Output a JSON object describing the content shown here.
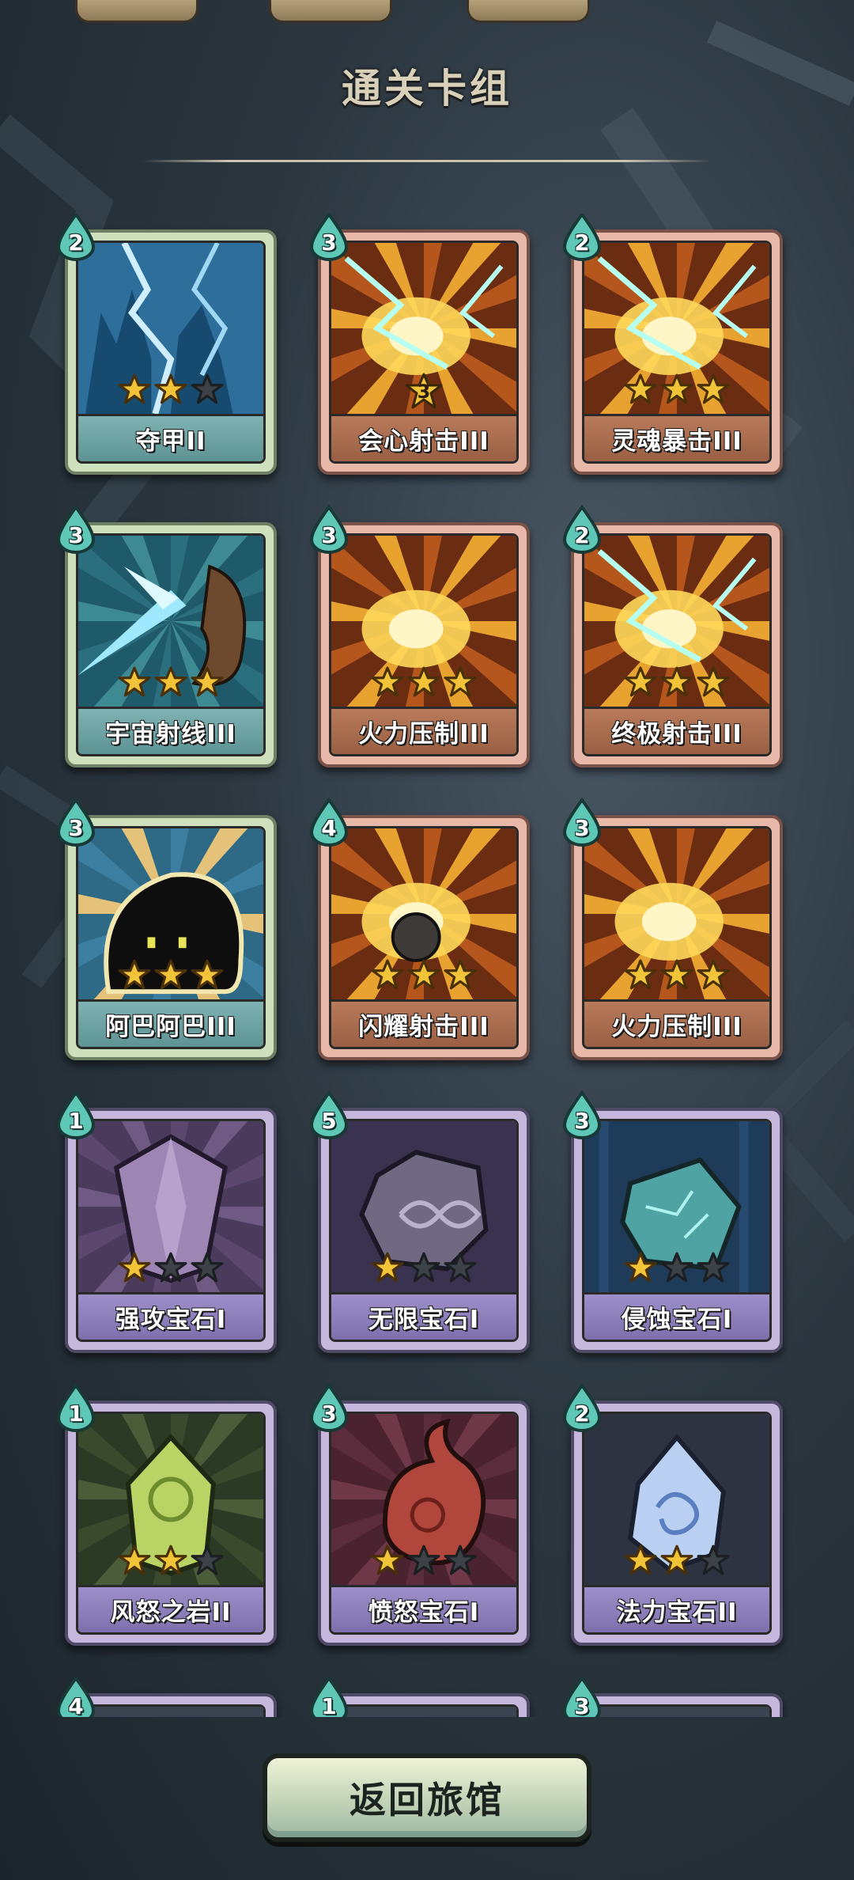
{
  "screen": {
    "title": "通关卡组"
  },
  "cards": [
    {
      "name": "夺甲II",
      "cost": "2",
      "stars": 2,
      "max_stars": 3,
      "rarity": "green",
      "art": "lightning-blue",
      "level": ""
    },
    {
      "name": "会心射击III",
      "cost": "3",
      "stars": 0,
      "max_stars": 3,
      "rarity": "pink",
      "art": "fire-bolt",
      "level": "3"
    },
    {
      "name": "灵魂暴击III",
      "cost": "2",
      "stars": 3,
      "max_stars": 3,
      "rarity": "pink",
      "art": "soul-strike",
      "level": ""
    },
    {
      "name": "宇宙射线III",
      "cost": "3",
      "stars": 3,
      "max_stars": 3,
      "rarity": "green",
      "art": "cosmic-ray",
      "level": ""
    },
    {
      "name": "火力压制III",
      "cost": "3",
      "stars": 3,
      "max_stars": 3,
      "rarity": "pink",
      "art": "fire-burst",
      "level": ""
    },
    {
      "name": "终极射击III",
      "cost": "2",
      "stars": 3,
      "max_stars": 3,
      "rarity": "pink",
      "art": "ultimate-shot",
      "level": ""
    },
    {
      "name": "阿巴阿巴III",
      "cost": "3",
      "stars": 3,
      "max_stars": 3,
      "rarity": "green",
      "art": "shadow-blob",
      "level": ""
    },
    {
      "name": "闪耀射击III",
      "cost": "4",
      "stars": 3,
      "max_stars": 3,
      "rarity": "pink",
      "art": "shine-shot",
      "level": ""
    },
    {
      "name": "火力压制III",
      "cost": "3",
      "stars": 3,
      "max_stars": 3,
      "rarity": "pink",
      "art": "fire-burst",
      "level": ""
    },
    {
      "name": "强攻宝石I",
      "cost": "1",
      "stars": 1,
      "max_stars": 3,
      "rarity": "purple",
      "art": "gem-purple",
      "level": ""
    },
    {
      "name": "无限宝石I",
      "cost": "5",
      "stars": 1,
      "max_stars": 3,
      "rarity": "purple",
      "art": "gem-infinity",
      "level": ""
    },
    {
      "name": "侵蚀宝石I",
      "cost": "3",
      "stars": 1,
      "max_stars": 3,
      "rarity": "purple",
      "art": "gem-teal",
      "level": ""
    },
    {
      "name": "风怒之岩II",
      "cost": "1",
      "stars": 2,
      "max_stars": 3,
      "rarity": "purple",
      "art": "gem-green",
      "level": ""
    },
    {
      "name": "愤怒宝石I",
      "cost": "3",
      "stars": 1,
      "max_stars": 3,
      "rarity": "purple",
      "art": "gem-red",
      "level": ""
    },
    {
      "name": "法力宝石II",
      "cost": "2",
      "stars": 2,
      "max_stars": 3,
      "rarity": "purple",
      "art": "gem-blue",
      "level": ""
    },
    {
      "name": "",
      "cost": "4",
      "stars": 0,
      "max_stars": 3,
      "rarity": "purple",
      "art": "hidden",
      "level": ""
    },
    {
      "name": "",
      "cost": "1",
      "stars": 0,
      "max_stars": 3,
      "rarity": "purple",
      "art": "hidden",
      "level": ""
    },
    {
      "name": "",
      "cost": "3",
      "stars": 0,
      "max_stars": 3,
      "rarity": "purple",
      "art": "hidden",
      "level": ""
    }
  ],
  "footer": {
    "back_label": "返回旅馆"
  },
  "colors": {
    "background": "#2c3740",
    "star_gold": "#f2c43a",
    "star_empty": "#3d4248",
    "cost_drop": "#5fc7b6"
  }
}
